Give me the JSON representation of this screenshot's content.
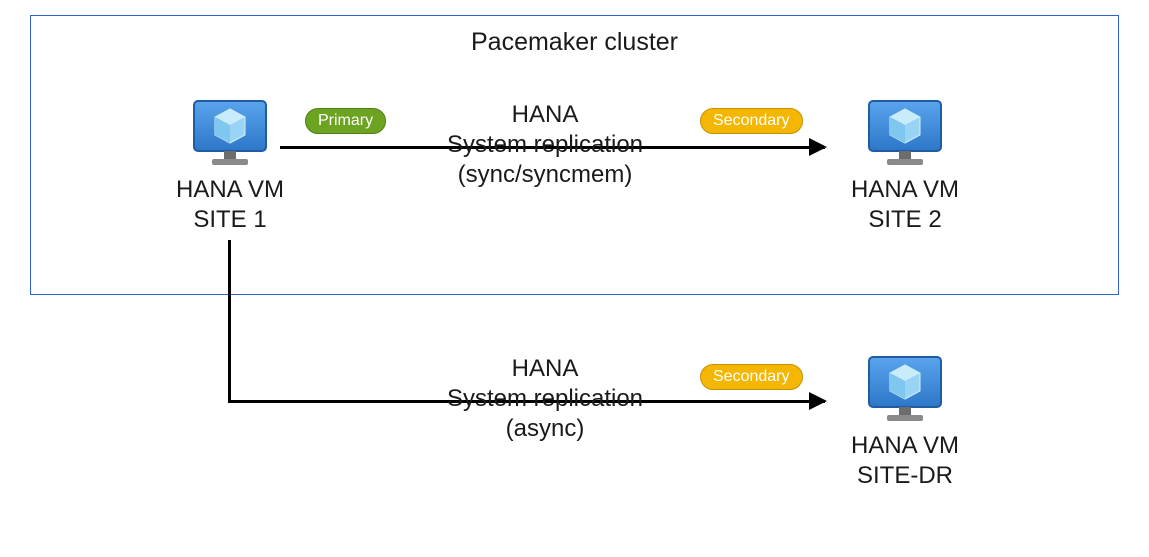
{
  "cluster": {
    "title": "Pacemaker cluster"
  },
  "nodes": {
    "site1": {
      "line1": "HANA VM",
      "line2": "SITE 1"
    },
    "site2": {
      "line1": "HANA VM",
      "line2": "SITE 2"
    },
    "dr": {
      "line1": "HANA VM",
      "line2": "SITE-DR"
    }
  },
  "pills": {
    "primary": "Primary",
    "secondary1": "Secondary",
    "secondary2": "Secondary"
  },
  "replication": {
    "sync": {
      "line1": "HANA",
      "line2": "System replication",
      "line3": "(sync/syncmem)"
    },
    "async": {
      "line1": "HANA",
      "line2": "System replication",
      "line3": "(async)"
    }
  },
  "colors": {
    "clusterBorder": "#2E62D2",
    "pillGreen": "#6CA422",
    "pillOrange": "#F5B600",
    "vmFill": "#3E8FE2",
    "vmEdge": "#2A6EB8"
  }
}
